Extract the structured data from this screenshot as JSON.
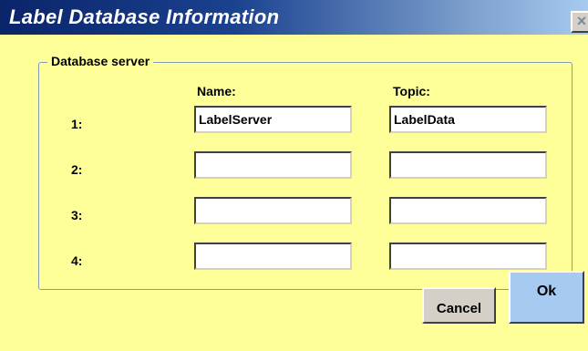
{
  "window": {
    "title": "Label Database Information",
    "close_glyph": "×"
  },
  "group": {
    "label": "Database server"
  },
  "columns": {
    "name_header": "Name:",
    "topic_header": "Topic:"
  },
  "rows": [
    {
      "label": "1:",
      "name": "LabelServer",
      "topic": "LabelData"
    },
    {
      "label": "2:",
      "name": "",
      "topic": ""
    },
    {
      "label": "3:",
      "name": "",
      "topic": ""
    },
    {
      "label": "4:",
      "name": "",
      "topic": ""
    }
  ],
  "buttons": {
    "cancel_label": "Cancel",
    "ok_label": "Ok"
  },
  "colors": {
    "dialog_background": "#ffff99",
    "titlebar_start": "#0a246a",
    "titlebar_end": "#a6caf0",
    "group_border": "#7f9db9"
  }
}
